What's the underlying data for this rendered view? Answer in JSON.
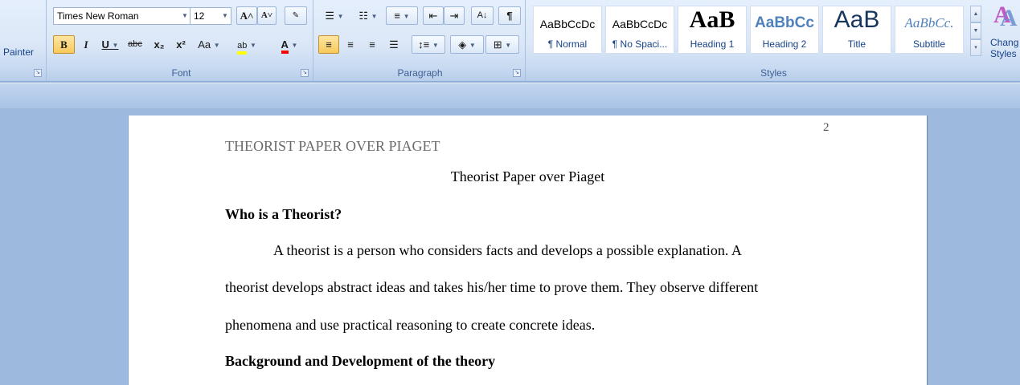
{
  "ribbon": {
    "painter_label": "Painter",
    "font": {
      "name": "Times New Roman",
      "size": "12",
      "label": "Font",
      "grow": "A˄",
      "shrink": "A˅",
      "bold": "B",
      "italic": "I",
      "underline": "U",
      "strike": "abc",
      "subscript": "x₂",
      "superscript": "x²",
      "change_case": "Aa",
      "highlight": "ab",
      "font_color": "A"
    },
    "paragraph": {
      "label": "Paragraph",
      "pilcrow": "¶"
    },
    "styles": {
      "label": "Styles",
      "items": [
        {
          "sample": "AaBbCcDc",
          "name": "¶ Normal"
        },
        {
          "sample": "AaBbCcDc",
          "name": "¶ No Spaci..."
        },
        {
          "sample": "AaB",
          "name": "Heading 1"
        },
        {
          "sample": "AaBbCc",
          "name": "Heading 2"
        },
        {
          "sample": "AaB",
          "name": "Title"
        },
        {
          "sample": "AaBbCc.",
          "name": "Subtitle"
        }
      ],
      "change_label_1": "Chang",
      "change_label_2": "Styles"
    }
  },
  "document": {
    "page_number": "2",
    "running_header": "THEORIST PAPER OVER PIAGET",
    "title": "Theorist Paper over Piaget",
    "heading1": "Who is a Theorist?",
    "lines": [
      "A theorist is a person who considers facts and develops a possible  explanation.  A",
      "theorist develops abstract ideas and takes his/her time to prove them. They observe  different",
      "phenomena and use practical reasoning  to create concrete ideas."
    ],
    "heading2": "Background and Development of the theory"
  },
  "colors": {
    "highlight": "#ffff00",
    "font_color": "#ff0000",
    "ribbon_text": "#15428b"
  }
}
